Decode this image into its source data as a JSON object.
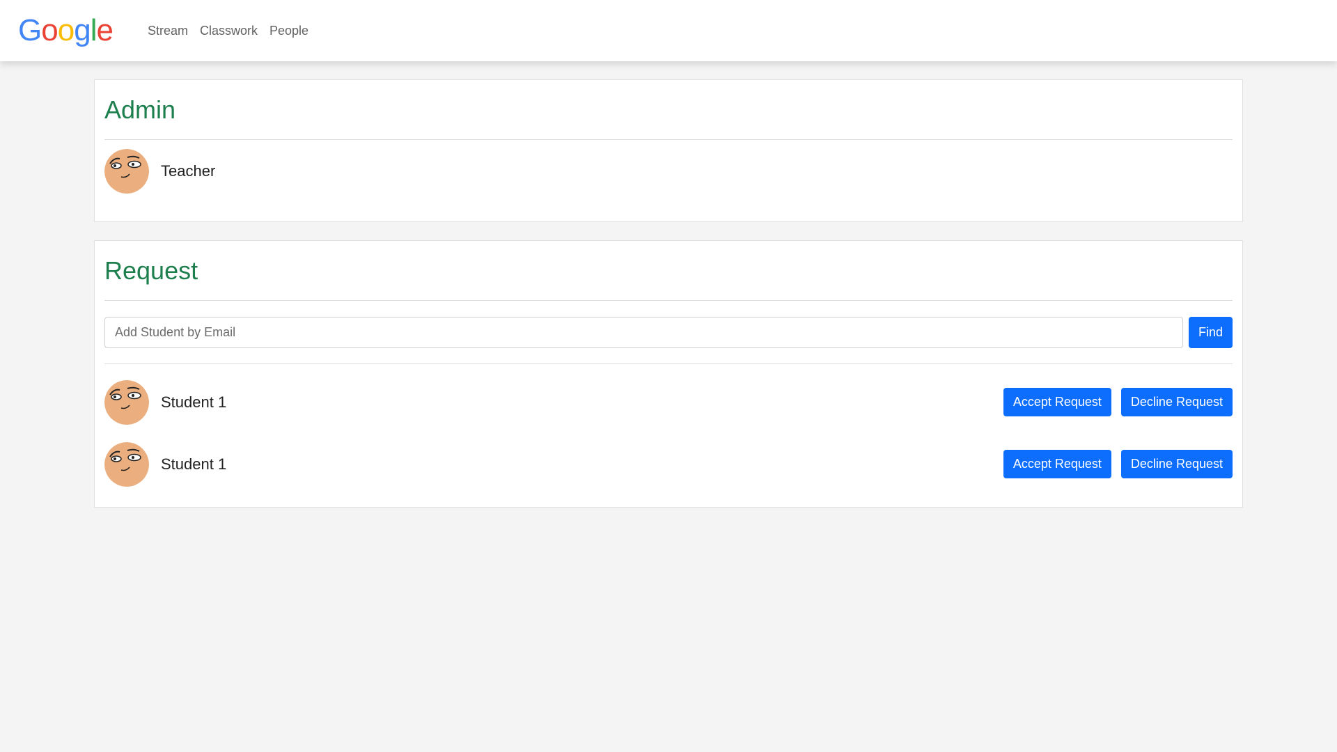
{
  "navbar": {
    "logo_letters": [
      "G",
      "o",
      "o",
      "g",
      "l",
      "e"
    ],
    "logo_colors": [
      "#4285F4",
      "#EA4335",
      "#FBBC05",
      "#4285F4",
      "#34A853",
      "#EA4335"
    ],
    "links": [
      "Stream",
      "Classwork",
      "People"
    ]
  },
  "admin": {
    "title": "Admin",
    "people": [
      {
        "name": "Teacher",
        "avatar_icon": "face-avatar-icon"
      }
    ]
  },
  "request": {
    "title": "Request",
    "search": {
      "placeholder": "Add Student by Email",
      "value": "",
      "button_label": "Find"
    },
    "students": [
      {
        "name": "Student 1",
        "accept_label": "Accept Request",
        "decline_label": "Decline Request"
      },
      {
        "name": "Student 1",
        "accept_label": "Accept Request",
        "decline_label": "Decline Request"
      }
    ]
  },
  "colors": {
    "heading_green": "#1e7f4e",
    "button_blue": "#0d6efd",
    "avatar_skin": "#EBAE7E",
    "page_bg": "#f4f4f4"
  }
}
